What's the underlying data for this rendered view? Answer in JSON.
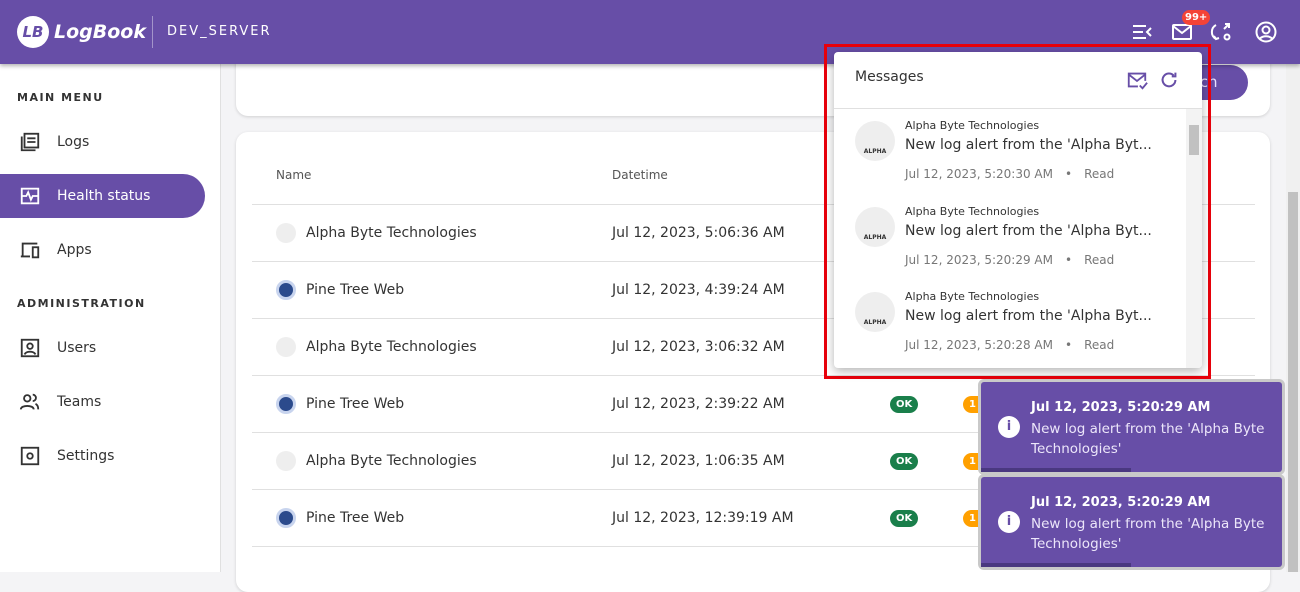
{
  "header": {
    "logo_mark": "LB",
    "app_name": "LogBook",
    "server": "DEV_SERVER",
    "badge": "99+"
  },
  "sidebar": {
    "main_menu": "MAIN MENU",
    "administration": "ADMINISTRATION",
    "items": [
      {
        "label": "Logs"
      },
      {
        "label": "Health status"
      },
      {
        "label": "Apps"
      },
      {
        "label": "Users"
      },
      {
        "label": "Teams"
      },
      {
        "label": "Settings"
      }
    ]
  },
  "search": {
    "label": "Search",
    "visible": "arch"
  },
  "table": {
    "headers": [
      "Name",
      "Datetime"
    ],
    "rows": [
      {
        "name": "Alpha Byte Technologies",
        "datetime": "Jul 12, 2023, 5:06:36 AM",
        "status": "",
        "count": ""
      },
      {
        "name": "Pine Tree Web",
        "datetime": "Jul 12, 2023, 4:39:24 AM",
        "status": "",
        "count": ""
      },
      {
        "name": "Alpha Byte Technologies",
        "datetime": "Jul 12, 2023, 3:06:32 AM",
        "status": "",
        "count": ""
      },
      {
        "name": "Pine Tree Web",
        "datetime": "Jul 12, 2023, 2:39:22 AM",
        "status": "OK",
        "count": "1"
      },
      {
        "name": "Alpha Byte Technologies",
        "datetime": "Jul 12, 2023, 1:06:35 AM",
        "status": "OK",
        "count": "1"
      },
      {
        "name": "Pine Tree Web",
        "datetime": "Jul 12, 2023, 12:39:19 AM",
        "status": "OK",
        "count": "1"
      }
    ]
  },
  "messages": {
    "title": "Messages",
    "avatar_text": "ALPHA",
    "items": [
      {
        "source": "Alpha Byte Technologies",
        "text": "New log alert from the 'Alpha Byt...",
        "time": "Jul 12, 2023, 5:20:30 AM",
        "state": "Read"
      },
      {
        "source": "Alpha Byte Technologies",
        "text": "New log alert from the 'Alpha Byt...",
        "time": "Jul 12, 2023, 5:20:29 AM",
        "state": "Read"
      },
      {
        "source": "Alpha Byte Technologies",
        "text": "New log alert from the 'Alpha Byt...",
        "time": "Jul 12, 2023, 5:20:28 AM",
        "state": "Read"
      }
    ]
  },
  "toasts": [
    {
      "title": "Jul 12, 2023, 5:20:29 AM",
      "body": "New log alert from the 'Alpha Byte Technologies'"
    },
    {
      "title": "Jul 12, 2023, 5:20:29 AM",
      "body": "New log alert from the 'Alpha Byte Technologies'"
    }
  ],
  "colors": {
    "primary": "#674ea7",
    "ok": "#1a7f4b",
    "warning": "#ffa000",
    "badge": "#f44336",
    "highlight": "#e8000b"
  }
}
